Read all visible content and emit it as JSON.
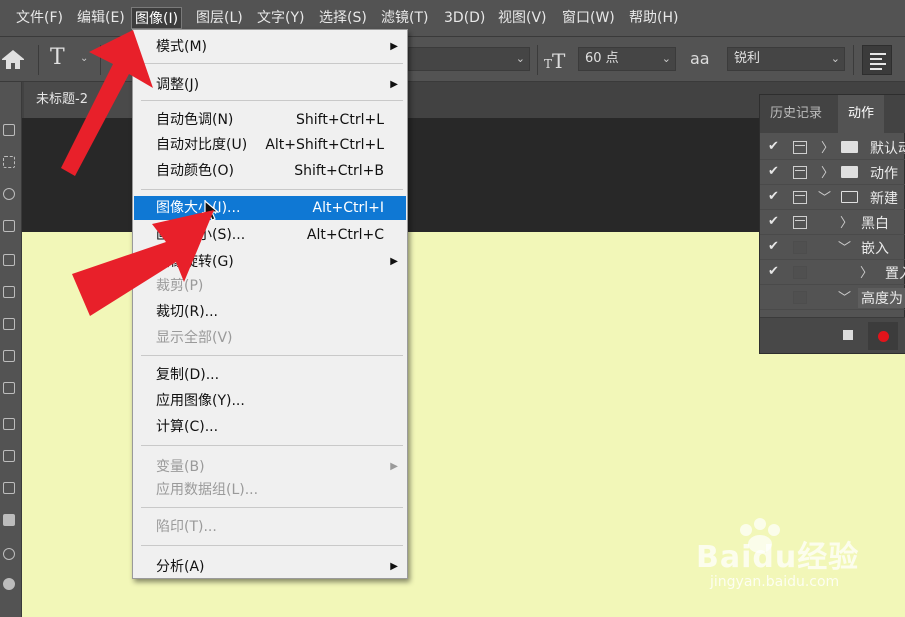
{
  "menubar": {
    "items": [
      {
        "label": "文件(F)"
      },
      {
        "label": "编辑(E)"
      },
      {
        "label": "图像(I)"
      },
      {
        "label": "图层(L)"
      },
      {
        "label": "文字(Y)"
      },
      {
        "label": "选择(S)"
      },
      {
        "label": "滤镜(T)"
      },
      {
        "label": "3D(D)"
      },
      {
        "label": "视图(V)"
      },
      {
        "label": "窗口(W)"
      },
      {
        "label": "帮助(H)"
      }
    ]
  },
  "options": {
    "tool_glyph": "T",
    "font_size": "60 点",
    "aa_glyph": "aa",
    "aa_value": "锐利"
  },
  "document": {
    "tab_title": "未标题-2"
  },
  "image_menu": {
    "items": [
      {
        "label": "模式(M)",
        "shortcut": "",
        "submenu": true,
        "disabled": false
      },
      {
        "label": "调整(J)",
        "shortcut": "",
        "submenu": true,
        "disabled": false
      },
      {
        "label": "自动色调(N)",
        "shortcut": "Shift+Ctrl+L",
        "submenu": false,
        "disabled": false
      },
      {
        "label": "自动对比度(U)",
        "shortcut": "Alt+Shift+Ctrl+L",
        "submenu": false,
        "disabled": false
      },
      {
        "label": "自动颜色(O)",
        "shortcut": "Shift+Ctrl+B",
        "submenu": false,
        "disabled": false
      },
      {
        "label": "图像大小(I)...",
        "shortcut": "Alt+Ctrl+I",
        "submenu": false,
        "disabled": false,
        "highlighted": true
      },
      {
        "label": "画布大小(S)...",
        "shortcut": "Alt+Ctrl+C",
        "submenu": false,
        "disabled": false
      },
      {
        "label": "图像旋转(G)",
        "shortcut": "",
        "submenu": true,
        "disabled": false
      },
      {
        "label": "裁剪(P)",
        "shortcut": "",
        "submenu": false,
        "disabled": true
      },
      {
        "label": "裁切(R)...",
        "shortcut": "",
        "submenu": false,
        "disabled": false
      },
      {
        "label": "显示全部(V)",
        "shortcut": "",
        "submenu": false,
        "disabled": true
      },
      {
        "label": "复制(D)...",
        "shortcut": "",
        "submenu": false,
        "disabled": false
      },
      {
        "label": "应用图像(Y)...",
        "shortcut": "",
        "submenu": false,
        "disabled": false
      },
      {
        "label": "计算(C)...",
        "shortcut": "",
        "submenu": false,
        "disabled": false
      },
      {
        "label": "变量(B)",
        "shortcut": "",
        "submenu": true,
        "disabled": true
      },
      {
        "label": "应用数据组(L)...",
        "shortcut": "",
        "submenu": false,
        "disabled": true
      },
      {
        "label": "陷印(T)...",
        "shortcut": "",
        "submenu": false,
        "disabled": true
      },
      {
        "label": "分析(A)",
        "shortcut": "",
        "submenu": true,
        "disabled": false
      }
    ]
  },
  "actions_panel": {
    "tab_history": "历史记录",
    "tab_actions": "动作",
    "rows": [
      {
        "label": "默认动"
      },
      {
        "label": "动作"
      },
      {
        "label": "新建"
      },
      {
        "label": "黑白"
      },
      {
        "label": "嵌入"
      },
      {
        "label": "置入"
      },
      {
        "label": "高度为"
      }
    ]
  },
  "watermark": {
    "brand": "Baidu经验",
    "url": "jingyan.baidu.com"
  },
  "colors": {
    "canvas": "#f2f7b8",
    "highlight": "#0f78d4",
    "arrow": "#e8202a",
    "record": "#e2141b"
  }
}
